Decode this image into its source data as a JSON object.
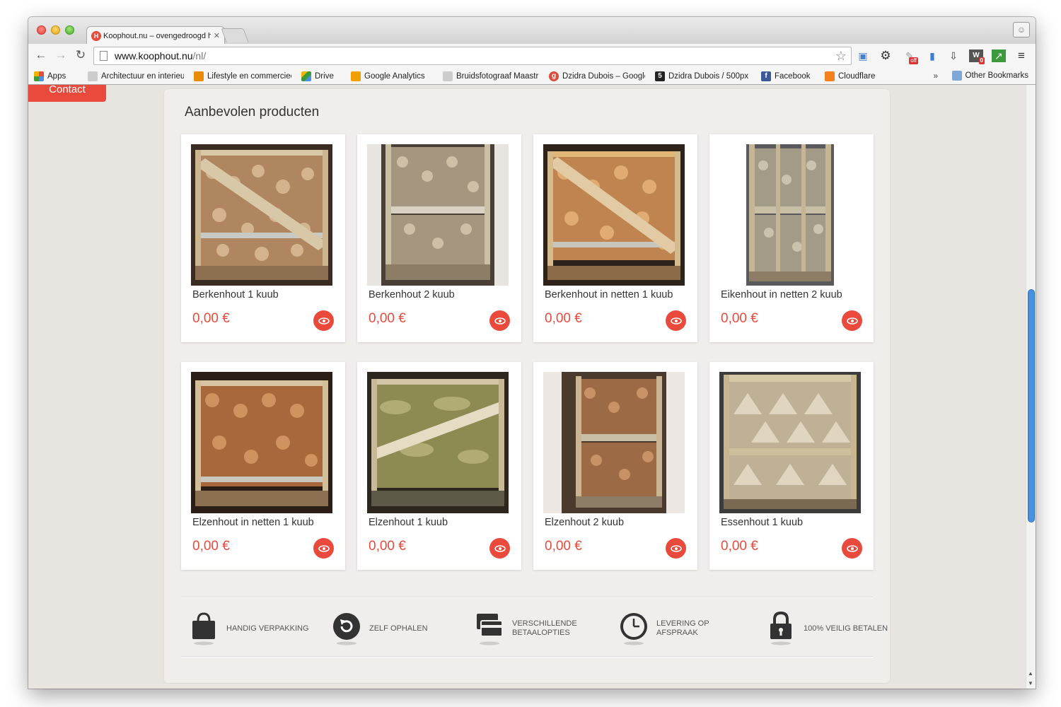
{
  "browser": {
    "tab_title": "Koophout.nu – ovengedroogd haardhout",
    "tab_favicon": "H",
    "url_host": "www.koophout.nu",
    "url_path": "/nl/",
    "bookmarks": [
      {
        "label": "Apps",
        "icon": "apps-grid-icon"
      },
      {
        "label": "Architectuur en interieur",
        "icon": "folder-page-icon"
      },
      {
        "label": "Lifestyle en commercieel",
        "icon": "folder-page-icon"
      },
      {
        "label": "Drive",
        "icon": "drive-icon"
      },
      {
        "label": "Google Analytics",
        "icon": "analytics-icon"
      },
      {
        "label": "Bruidsfotograaf Maastricht",
        "icon": "folder-page-icon"
      },
      {
        "label": "Dzidra Dubois – Google+",
        "icon": "google-plus-icon"
      },
      {
        "label": "Dzidra Dubois / 500px",
        "icon": "500px-icon"
      },
      {
        "label": "Facebook",
        "icon": "facebook-icon"
      },
      {
        "label": "Cloudflare",
        "icon": "cloudflare-icon"
      }
    ],
    "bookmarks_more": "»",
    "other_bookmarks": "Other Bookmarks",
    "extension_badges": {
      "off": "off",
      "count": "0"
    }
  },
  "page": {
    "contact_label": "Contact",
    "section_title": "Aanbevolen producten",
    "products": [
      {
        "name": "Berkenhout 1 kuub",
        "price": "0,00 €"
      },
      {
        "name": "Berkenhout 2 kuub",
        "price": "0,00 €"
      },
      {
        "name": "Berkenhout in netten 1 kuub",
        "price": "0,00 €"
      },
      {
        "name": "Eikenhout in netten 2 kuub",
        "price": "0,00 €"
      },
      {
        "name": "Elzenhout in netten 1 kuub",
        "price": "0,00 €"
      },
      {
        "name": "Elzenhout 1 kuub",
        "price": "0,00 €"
      },
      {
        "name": "Elzenhout 2 kuub",
        "price": "0,00 €"
      },
      {
        "name": "Essenhout 1 kuub",
        "price": "0,00 €"
      }
    ],
    "features": [
      {
        "label": "Handig verpakking",
        "icon": "shopping-bag-icon"
      },
      {
        "label": "Zelf ophalen",
        "icon": "refresh-icon"
      },
      {
        "label": "Verschillende betaalopties",
        "icon": "credit-card-icon"
      },
      {
        "label": "Levering op afspraak",
        "icon": "clock-icon"
      },
      {
        "label": "100% veilig betalen",
        "icon": "padlock-icon"
      }
    ]
  },
  "colors": {
    "accent": "#ea4a3c",
    "page_background": "#e8e4e0",
    "panel_background": "#f0eeeb",
    "scroll_thumb": "#4a90e2"
  }
}
